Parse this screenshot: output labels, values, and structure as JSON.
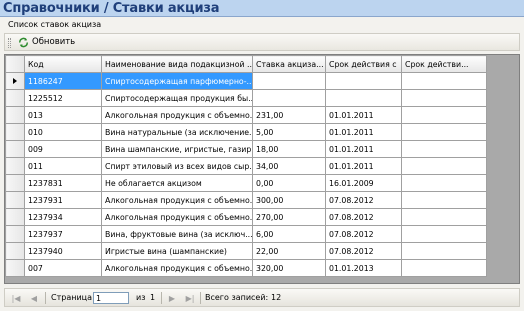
{
  "header": {
    "title": "Справочники / Ставки акциза"
  },
  "section": {
    "caption": "Список ставок акциза"
  },
  "toolbar": {
    "refresh_label": "Обновить"
  },
  "grid": {
    "columns": [
      "Код",
      "Наименование вида подакцизной ...",
      "Ставка акциза...",
      "Срок действия с",
      "Срок действи..."
    ],
    "rows": [
      [
        "1186247",
        "Спиртосодержащая парфюмерно-...",
        "",
        "",
        ""
      ],
      [
        "1225512",
        "Спиртосодержащая продукция бы...",
        "",
        "",
        ""
      ],
      [
        "013",
        "Алкогольная продукция с объемно...",
        "231,00",
        "01.01.2011",
        ""
      ],
      [
        "010",
        "Вина натуральные (за исключение...",
        "5,00",
        "01.01.2011",
        ""
      ],
      [
        "009",
        "Вина шампанские, игристые, газир...",
        "18,00",
        "01.01.2011",
        ""
      ],
      [
        "011",
        "Спирт этиловый из всех видов сыр...",
        "34,00",
        "01.01.2011",
        ""
      ],
      [
        "1237831",
        "Не облагается акцизом",
        "0,00",
        "16.01.2009",
        ""
      ],
      [
        "1237931",
        "Алкогольная продукция с объемно...",
        "300,00",
        "07.08.2012",
        ""
      ],
      [
        "1237934",
        "Алкогольная продукция с объемно...",
        "270,00",
        "07.08.2012",
        ""
      ],
      [
        "1237937",
        "Вина, фруктовые вина (за исключ...",
        "6,00",
        "07.08.2012",
        ""
      ],
      [
        "1237940",
        "Игристые вина (шампанские)",
        "22,00",
        "07.08.2012",
        ""
      ],
      [
        "007",
        "Алкогольная продукция с объемно...",
        "320,00",
        "01.01.2013",
        ""
      ]
    ],
    "selected_row": 0
  },
  "navigator": {
    "page_label": "Страница",
    "page_value": "1",
    "of_label": "из",
    "total_pages": "1",
    "total_records_label": "Всего записей:",
    "total_records": "12"
  },
  "colors": {
    "title_text": "#1f3f7a",
    "selection": "#3399ff"
  }
}
